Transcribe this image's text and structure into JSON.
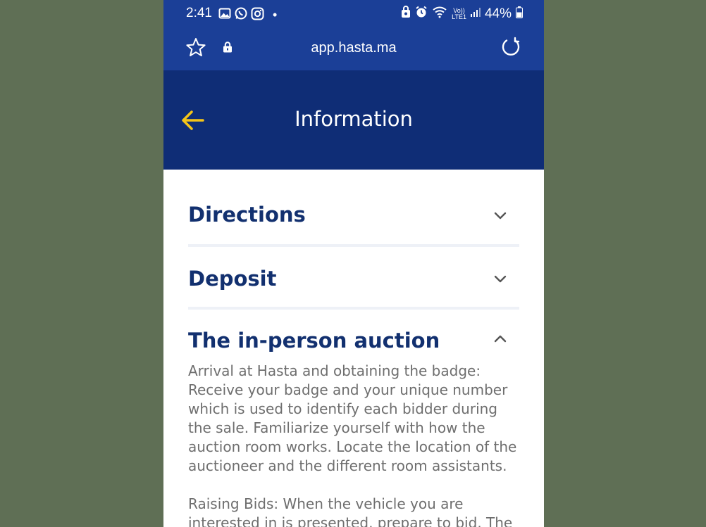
{
  "status_bar": {
    "time": "2:41",
    "dot": "•",
    "battery_percent": "44%",
    "network_label": "LTE1",
    "volte_label": "Vo))",
    "left_icons": [
      "image-icon",
      "whatsapp-icon",
      "instagram-icon"
    ],
    "right_icons": [
      "nfc-lock-icon",
      "alarm-icon",
      "wifi-icon",
      "signal-icon",
      "battery-icon"
    ]
  },
  "browser": {
    "url": "app.hasta.ma"
  },
  "app_bar": {
    "title": "Information"
  },
  "colors": {
    "status_bg": "#1b3f97",
    "appbar_bg": "#0f2d76",
    "accent_arrow": "#f5c518",
    "heading": "#12306f",
    "body_text": "#6e6e6e",
    "divider": "#eef1f7",
    "page_bg": "#5f6f55"
  },
  "sections": [
    {
      "title": "Directions",
      "expanded": false
    },
    {
      "title": "Deposit",
      "expanded": false
    },
    {
      "title": "The in-person auction",
      "expanded": true,
      "paragraphs": [
        "Arrival at Hasta and obtaining the badge: Receive your badge and your unique number which is used to identify each bidder during the sale. Familiarize yourself with how the auction room works. Locate the location of the auctioneer and the different room assistants.",
        "Raising Bids: When the vehicle you are interested in is presented, prepare to bid. The"
      ]
    }
  ]
}
